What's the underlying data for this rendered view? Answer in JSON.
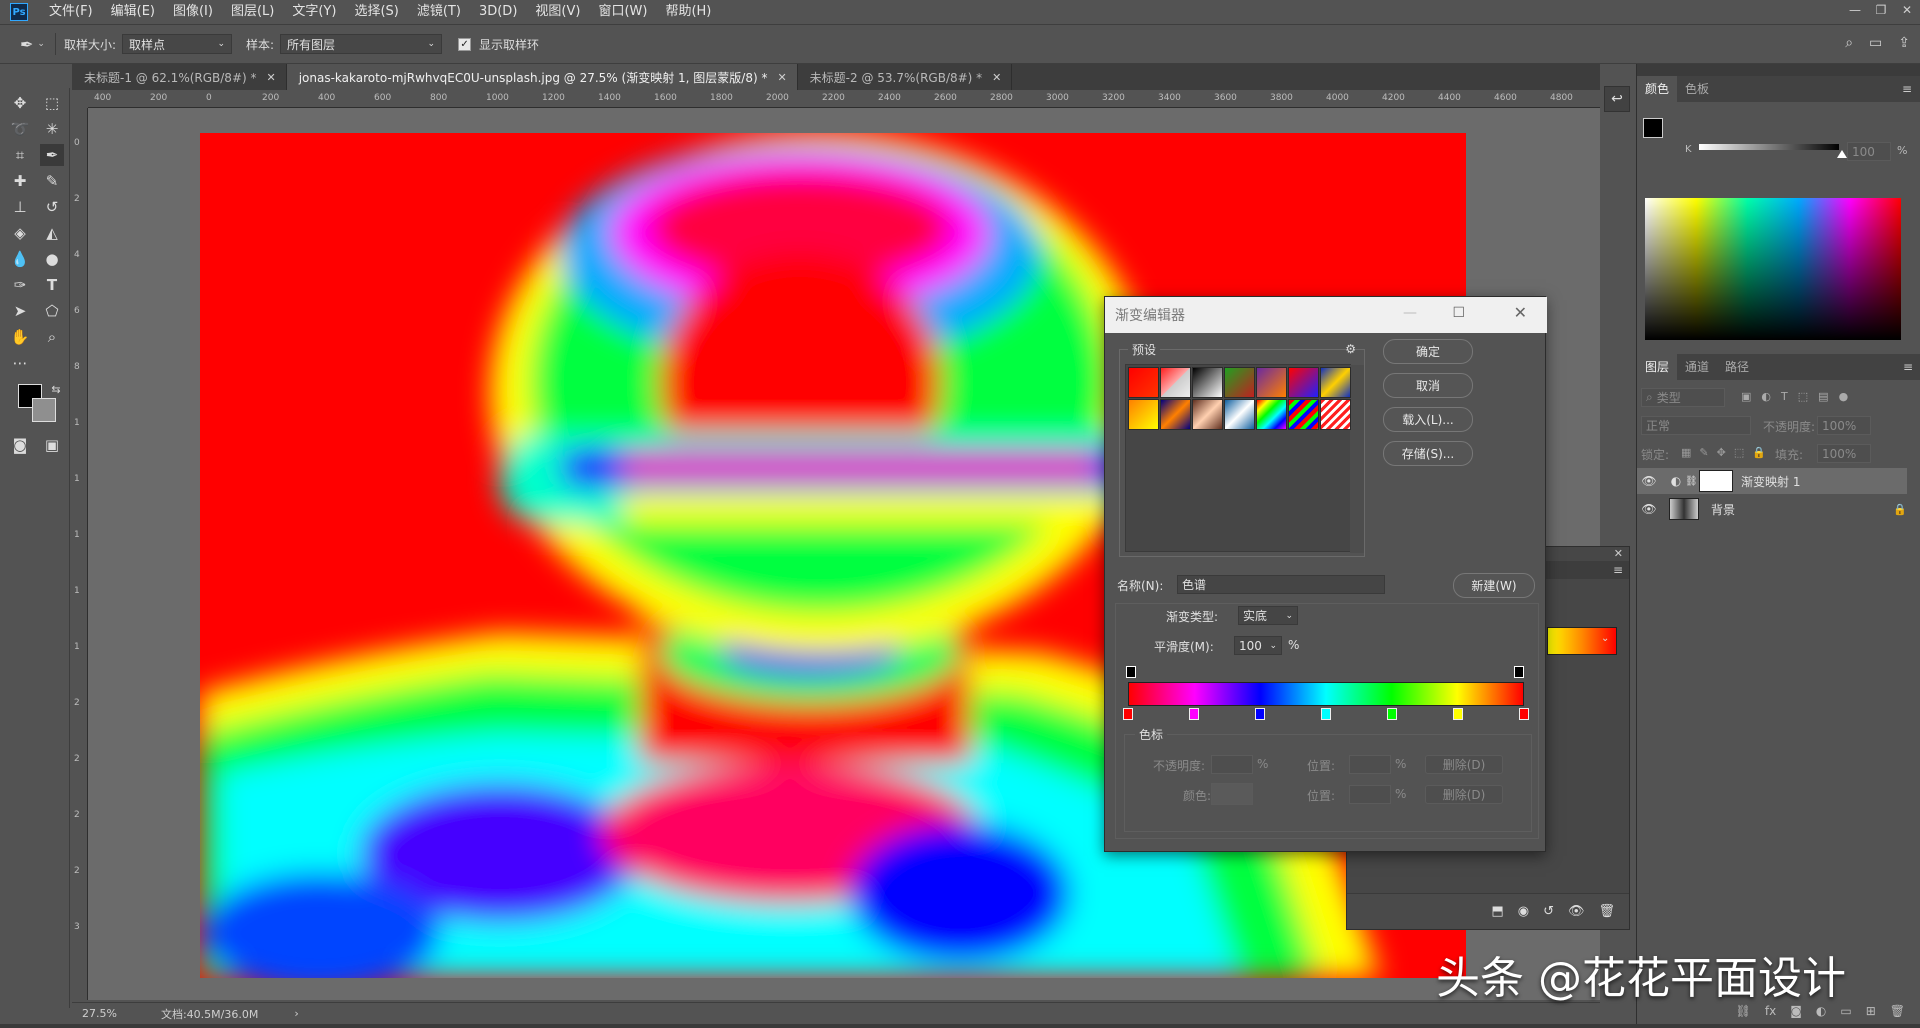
{
  "app": {
    "logo": "Ps",
    "menu": [
      "文件(F)",
      "编辑(E)",
      "图像(I)",
      "图层(L)",
      "文字(Y)",
      "选择(S)",
      "滤镜(T)",
      "3D(D)",
      "视图(V)",
      "窗口(W)",
      "帮助(H)"
    ]
  },
  "options": {
    "sample_size_label": "取样大小:",
    "sample_size_value": "取样点",
    "sample_label": "样本:",
    "sample_value": "所有图层",
    "show_ring_label": "显示取样环",
    "show_ring_checked": true
  },
  "tabs": [
    {
      "label": "未标题-1 @ 62.1%(RGB/8#) *",
      "active": false
    },
    {
      "label": "jonas-kakaroto-mjRwhvqEC0U-unsplash.jpg @ 27.5% (渐变映射 1, 图层蒙版/8) *",
      "active": true
    },
    {
      "label": "未标题-2 @ 53.7%(RGB/8#) *",
      "active": false
    }
  ],
  "ruler": {
    "h_ticks": [
      "400",
      "200",
      "0",
      "200",
      "400",
      "600",
      "800",
      "1000",
      "1200",
      "1400",
      "1600",
      "1800",
      "2000",
      "2200",
      "2400",
      "2600",
      "2800",
      "3000",
      "3200",
      "3400",
      "3600",
      "3800",
      "4000",
      "4200",
      "4400",
      "4600",
      "4800"
    ],
    "v_ticks": [
      "0",
      "2",
      "4",
      "6",
      "8",
      "1",
      "1",
      "1",
      "1",
      "1",
      "2",
      "2",
      "2",
      "2",
      "3"
    ]
  },
  "status": {
    "zoom": "27.5%",
    "doc": "文档:40.5M/36.0M"
  },
  "color_panel": {
    "tabs": [
      "颜色",
      "色板"
    ],
    "k_label": "K",
    "k_value": "100",
    "k_unit": "%"
  },
  "layers_panel": {
    "tabs": [
      "图层",
      "通道",
      "路径"
    ],
    "filter_placeholder": "类型",
    "blend_mode": "正常",
    "opacity_label": "不透明度:",
    "opacity_value": "100%",
    "lock_label": "锁定:",
    "fill_label": "填充:",
    "fill_value": "100%",
    "layers": [
      {
        "name": "渐变映射 1",
        "selected": true
      },
      {
        "name": "背景",
        "selected": false
      }
    ]
  },
  "dialog": {
    "title": "渐变编辑器",
    "presets_label": "预设",
    "buttons": {
      "ok": "确定",
      "cancel": "取消",
      "load": "载入(L)...",
      "save": "存储(S)...",
      "new": "新建(W)"
    },
    "name_label": "名称(N):",
    "name_value": "色谱",
    "type_label": "渐变类型:",
    "type_value": "实底",
    "smooth_label": "平滑度(M):",
    "smooth_value": "100",
    "smooth_unit": "%",
    "stops_label": "色标",
    "opacity_label": "不透明度:",
    "percent": "%",
    "position_label": "位置:",
    "delete_label": "删除(D)",
    "color_label": "颜色:",
    "gradient_stops": [
      "#ff0000",
      "#ff00ff",
      "#0000ff",
      "#00ffff",
      "#00ff00",
      "#ffff00",
      "#ff0000"
    ]
  },
  "watermark": "头条 @花花平面设计"
}
